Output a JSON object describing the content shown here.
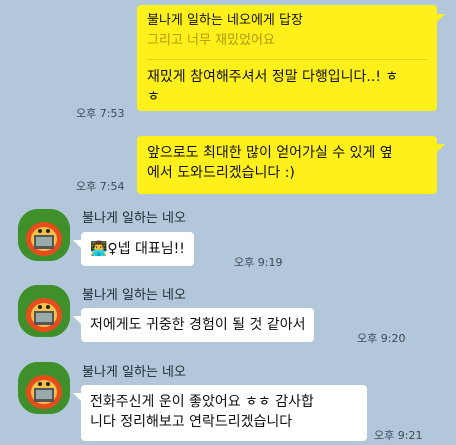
{
  "messages_mine": [
    {
      "reply_header": "불나게 일하는 네오에게 답장",
      "reply_quote": "그리고 너무 재밌었어요",
      "text_lines": [
        "재밌게 참여해주셔서 정말 다행입니다..! ㅎ",
        "ㅎ"
      ],
      "time": "오후 7:53"
    },
    {
      "text_lines": [
        "앞으로도 최대한 많이 얻어가실 수 있게 옆",
        "에서 도와드리겠습니다 :)"
      ],
      "time": "오후 7:54"
    }
  ],
  "messages_theirs": [
    {
      "sender": "불나게 일하는 네오",
      "text_lines": [
        "👨‍💻♀넵 대표님!!"
      ],
      "time": "오후 9:19"
    },
    {
      "sender": "불나게 일하는 네오",
      "text_lines": [
        "저에게도 귀중한 경험이 될 것 같아서"
      ],
      "time": "오후 9:20"
    },
    {
      "sender": "불나게 일하는 네오",
      "text_lines": [
        "전화주신게 운이 좋았어요 ㅎㅎ 감사합",
        "니다 정리해보고 연락드리겠습니다"
      ],
      "time": "오후 9:21"
    }
  ],
  "colors": {
    "background": "#b2c7da",
    "my_bubble": "#fef01b",
    "their_bubble": "#ffffff",
    "avatar_bg": "#3f8f2b"
  },
  "icons": {
    "avatar": "neo-character-avatar-icon"
  }
}
